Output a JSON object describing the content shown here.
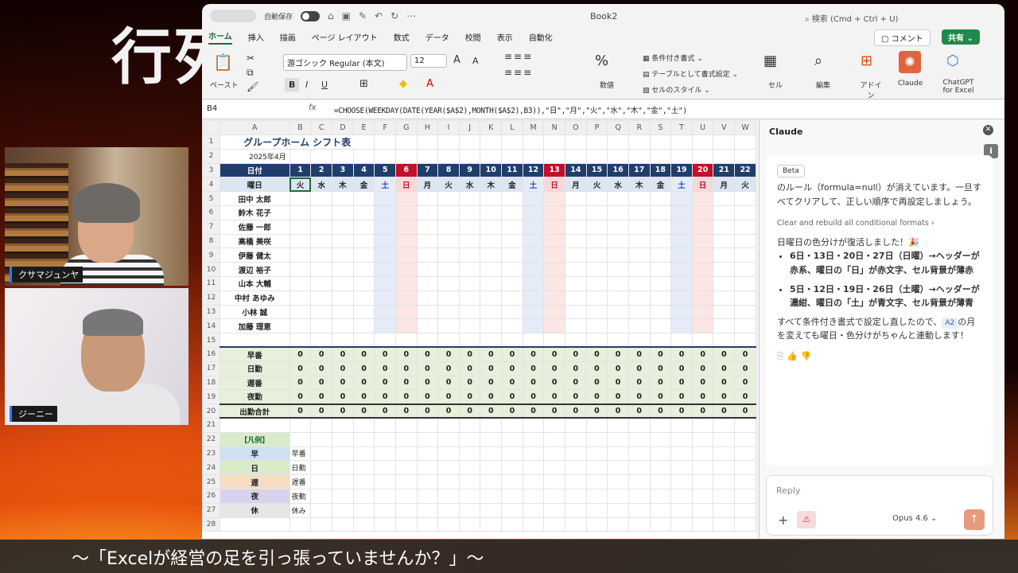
{
  "overlay": {
    "big_title": "行列",
    "subtitle": "〜「Excelが経営の足を引っ張っていませんか？」〜",
    "cam1_name": "クサマジュンヤ",
    "cam2_name": "ジーニー"
  },
  "window": {
    "autosave": "自動保存",
    "book": "Book2",
    "search": "検索 (Cmd + Ctrl + U)"
  },
  "menu": [
    "ホーム",
    "挿入",
    "描画",
    "ページ レイアウト",
    "数式",
    "データ",
    "校閲",
    "表示",
    "自動化"
  ],
  "ribbon": {
    "paste": "ペースト",
    "font": "游ゴシック Regular (本文)",
    "size": "12",
    "number": "数値",
    "cond_format": "条件付き書式",
    "table_format": "テーブルとして書式設定",
    "cell_style": "セルのスタイル",
    "cells": "セル",
    "edit": "編集",
    "addin": "アドイン",
    "claude": "Claude",
    "chatgpt": "ChatGPT for Excel",
    "comment": "コメント",
    "share": "共有"
  },
  "formula_bar": {
    "cell": "B4",
    "formula": "=CHOOSE(WEEKDAY(DATE(YEAR($A$2),MONTH($A$2),B3)),\"日\",\"月\",\"火\",\"水\",\"木\",\"金\",\"土\")"
  },
  "sheet": {
    "columns": [
      "A",
      "B",
      "C",
      "D",
      "E",
      "F",
      "G",
      "H",
      "I",
      "J",
      "K",
      "L",
      "M",
      "N",
      "O",
      "P",
      "Q",
      "R",
      "S",
      "T",
      "U",
      "V",
      "W"
    ],
    "title": "グループホーム シフト表",
    "month": "2025年4月",
    "date_label": "日付",
    "weekday_label": "曜日",
    "days": [
      "1",
      "2",
      "3",
      "4",
      "5",
      "6",
      "7",
      "8",
      "9",
      "10",
      "11",
      "12",
      "13",
      "14",
      "15",
      "16",
      "17",
      "18",
      "19",
      "20",
      "21",
      "22"
    ],
    "weekdays": [
      "火",
      "水",
      "木",
      "金",
      "土",
      "日",
      "月",
      "火",
      "水",
      "木",
      "金",
      "土",
      "日",
      "月",
      "火",
      "水",
      "木",
      "金",
      "土",
      "日",
      "月",
      "火"
    ],
    "staff": [
      "田中 太郎",
      "鈴木 花子",
      "佐藤 一郎",
      "高橋 美咲",
      "伊藤 健太",
      "渡辺 裕子",
      "山本 大輔",
      "中村 あゆみ",
      "小林 誠",
      "加藤 理恵"
    ],
    "totals": [
      "早番",
      "日勤",
      "遅番",
      "夜勤"
    ],
    "grand_total": "出勤合計",
    "zero": "0",
    "legend_title": "【凡例】",
    "legend": [
      {
        "code": "早",
        "label": "早番",
        "color": "#cfe0f3"
      },
      {
        "code": "日",
        "label": "日勤",
        "color": "#d9ecc9"
      },
      {
        "code": "遅",
        "label": "遅番",
        "color": "#f8dcc6"
      },
      {
        "code": "夜",
        "label": "夜勤",
        "color": "#d9d2ec"
      },
      {
        "code": "休",
        "label": "休み",
        "color": "#e6e6e6"
      }
    ]
  },
  "claude_panel": {
    "title": "Claude",
    "beta": "Beta",
    "intro1": "のルール（formula=null）が消えています。一旦すべてクリアして、正しい順序で再設定しましょう。",
    "link": "Clear and rebuild all conditional formats",
    "restored": "日曜日の色分けが復活しました！🎉",
    "bullet1": "6日・13日・20日・27日（日曜）→ヘッダーが赤系、曜日の「日」が赤文字、セル背景が薄赤",
    "bullet2": "5日・12日・19日・26日（土曜）→ヘッダーが濃紺、曜日の「土」が青文字、セル背景が薄青",
    "outro_a": "すべて条件付き書式で設定し直したので、",
    "chip": "A2",
    "outro_b": "の月を変えても曜日・色分けがちゃんと連動します！",
    "reply_placeholder": "Reply",
    "model": "Opus 4.6"
  }
}
